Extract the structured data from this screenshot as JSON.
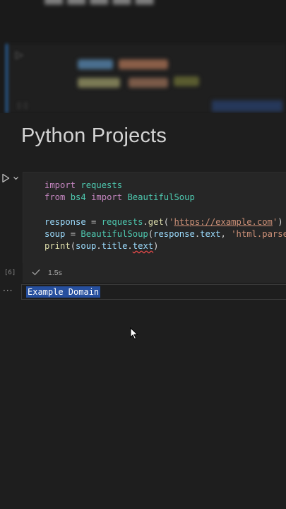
{
  "notebook": {
    "title": "Python Projects"
  },
  "cell": {
    "execution_count": "[6]",
    "exec_time": "1.5s",
    "code_lines": [
      "import requests",
      "from bs4 import BeautifulSoup",
      "",
      "response = requests.get('https://example.com')",
      "soup = BeautifulSoup(response.text, 'html.parser')",
      "print(soup.title.text)"
    ]
  },
  "output": {
    "text": "Example Domain"
  },
  "icons": {
    "run": "play-icon",
    "run_options": "chevron-down-icon",
    "status": "check-icon",
    "output_menu": "ellipsis-icon",
    "pointer": "mouse-cursor-icon"
  },
  "colors": {
    "background": "#1e1e1e",
    "cell_background": "#262626",
    "keyword": "#c586c0",
    "class": "#4ec9b0",
    "variable": "#9cdcfe",
    "function": "#dcdcaa",
    "string": "#ce9178",
    "selection": "#264f9e"
  }
}
